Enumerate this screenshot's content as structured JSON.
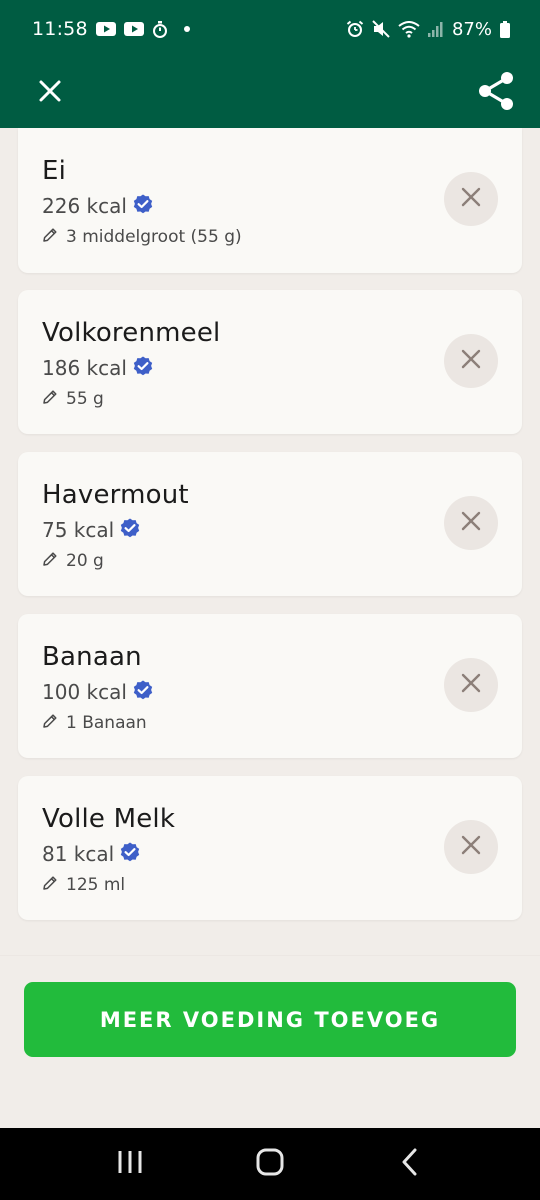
{
  "status_bar": {
    "time": "11:58",
    "battery": "87%",
    "icons": [
      "youtube-icon",
      "youtube-icon",
      "timer-icon",
      "dot-icon",
      "alarm-icon",
      "mute-icon",
      "wifi-icon",
      "signal-icon",
      "battery-icon"
    ]
  },
  "header": {
    "close_icon": "close-icon",
    "share_icon": "share-icon",
    "background_color": "#005c42"
  },
  "foods": [
    {
      "name": "Ei",
      "kcal": "226 kcal",
      "portion": "3 middelgroot (55 g)",
      "verified": true
    },
    {
      "name": "Volkorenmeel",
      "kcal": "186 kcal",
      "portion": "55 g",
      "verified": true
    },
    {
      "name": "Havermout",
      "kcal": "75 kcal",
      "portion": "20 g",
      "verified": true
    },
    {
      "name": "Banaan",
      "kcal": "100 kcal",
      "portion": "1 Banaan",
      "verified": true
    },
    {
      "name": "Volle Melk",
      "kcal": "81 kcal",
      "portion": "125 ml",
      "verified": true
    }
  ],
  "actions": {
    "add_more_label": "MEER VOEDING TOEVOEG",
    "button_color": "#22bb3c"
  },
  "nav": {
    "icons": [
      "recent-apps-icon",
      "home-icon",
      "back-icon"
    ]
  },
  "colors": {
    "verified": "#3e5fc8",
    "remove_bg": "#ebe6e2",
    "card_bg": "#faf9f6"
  }
}
